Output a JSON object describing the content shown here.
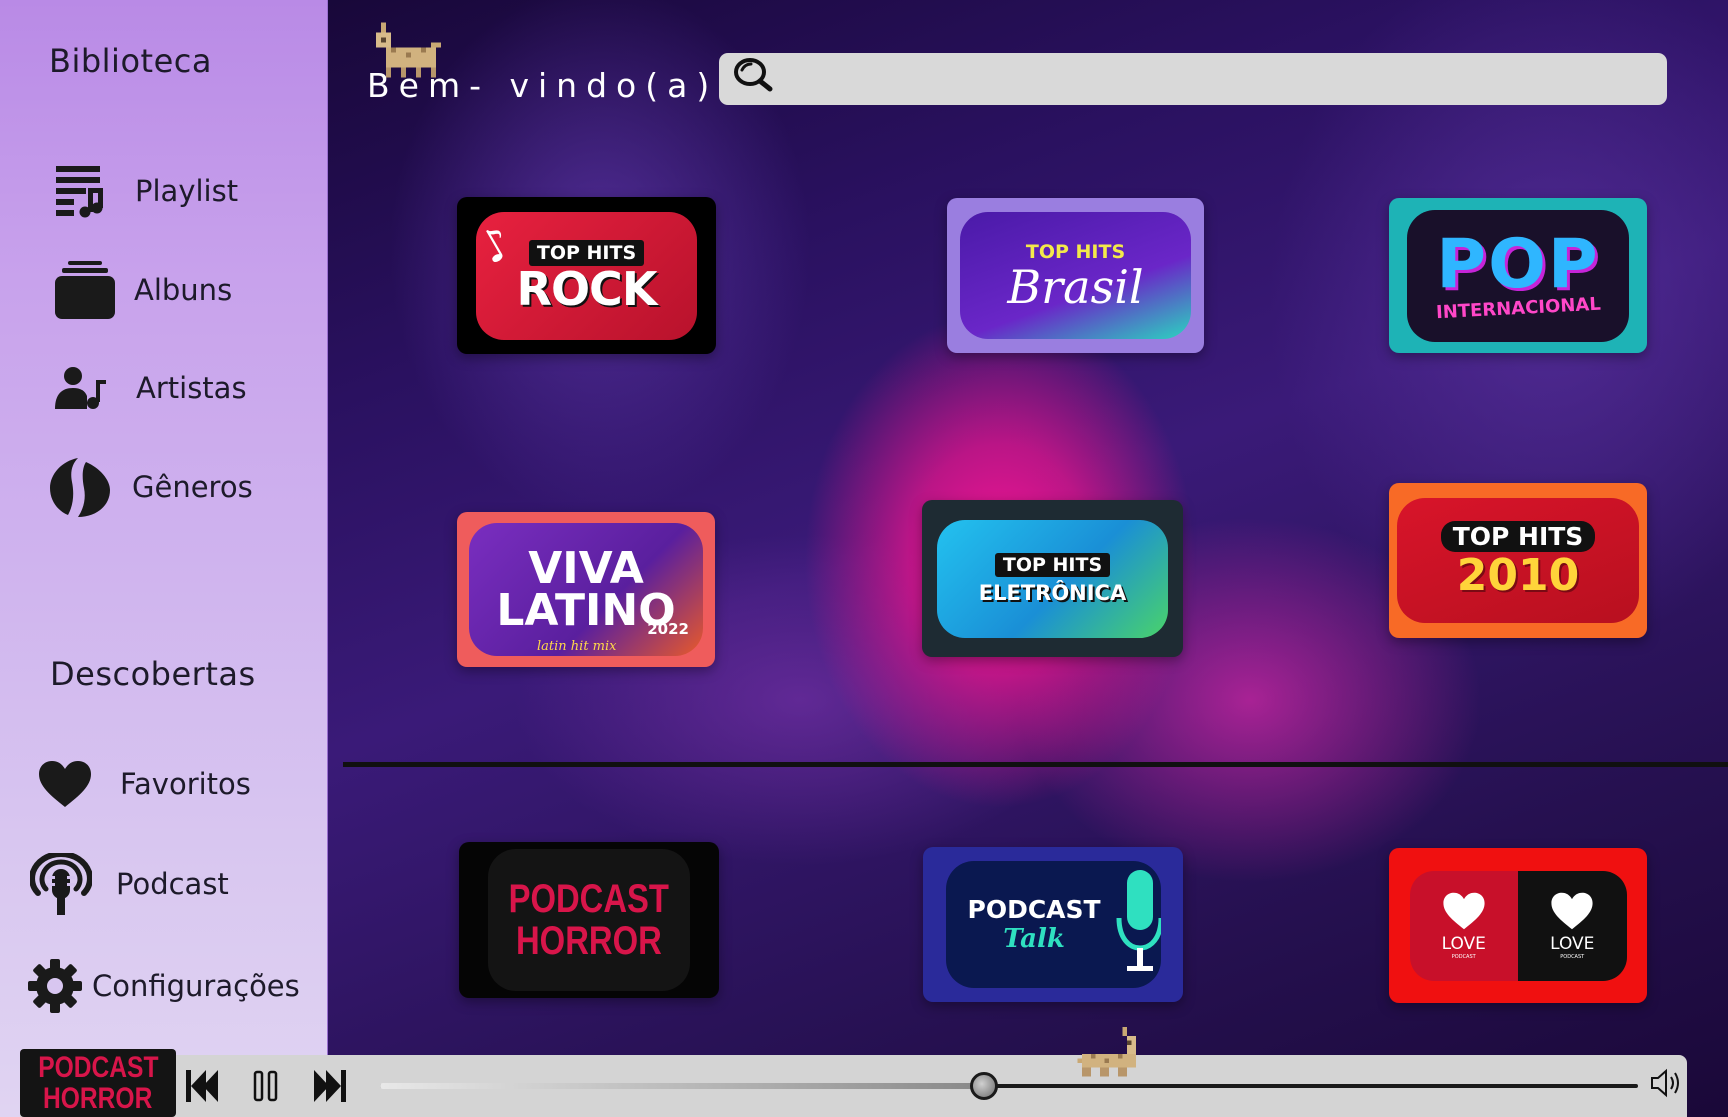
{
  "sidebar": {
    "library_heading": "Biblioteca",
    "library_items": [
      {
        "label": "Playlist",
        "icon": "playlist-icon"
      },
      {
        "label": "Albuns",
        "icon": "album-icon"
      },
      {
        "label": "Artistas",
        "icon": "artist-icon"
      },
      {
        "label": "Gêneros",
        "icon": "genre-icon"
      }
    ],
    "discover_heading": "Descobertas",
    "discover_items": [
      {
        "label": "Favoritos",
        "icon": "heart-icon"
      },
      {
        "label": "Podcast",
        "icon": "podcast-icon"
      },
      {
        "label": "Configurações",
        "icon": "gear-icon"
      }
    ]
  },
  "header": {
    "welcome": "Bem- vindo(a)",
    "search_placeholder": ""
  },
  "playlists": [
    {
      "line1": "TOP HITS",
      "line2": "ROCK",
      "frame_color": "#000000",
      "cover_color": "#e21c3b"
    },
    {
      "line1": "TOP HITS",
      "line2": "Brasil",
      "frame_color": "#9a7ee0",
      "cover_color": "#5b1fb8"
    },
    {
      "line1": "POP",
      "line2": "INTERNACIONAL",
      "frame_color": "#1eb3b6",
      "cover_color": "#19102a"
    },
    {
      "line1": "VIVA",
      "line2": "LATINO",
      "line3": "2022",
      "line4": "latin hit mix",
      "frame_color": "#ef5c5c",
      "cover_color": "#6a2bb0"
    },
    {
      "line1": "TOP HITS",
      "line2": "ELETRÔNICA",
      "frame_color": "#1e2b33",
      "cover_color": "#1fb0e0"
    },
    {
      "line1": "TOP HITS",
      "line2": "2010",
      "frame_color": "#f86a26",
      "cover_color": "#d8142a"
    }
  ],
  "podcasts": [
    {
      "line1": "PODCAST",
      "line2": "HORROR",
      "frame_color": "#050505",
      "cover_color": "#141414"
    },
    {
      "line1": "PODCAST",
      "line2": "Talk",
      "frame_color": "#2a2a9a",
      "cover_color": "#0a1850"
    },
    {
      "line1": "LOVE",
      "line2": "PODCAST",
      "line3": "LOVE",
      "line4": "PODCAST",
      "frame_color": "#f01010",
      "cover_color": "#c8102a"
    }
  ],
  "player": {
    "now_playing_line1": "PODCAST",
    "now_playing_line2": "HORROR",
    "progress": 0.48,
    "controls": [
      "previous-icon",
      "pause-icon",
      "next-icon",
      "volume-icon"
    ]
  }
}
